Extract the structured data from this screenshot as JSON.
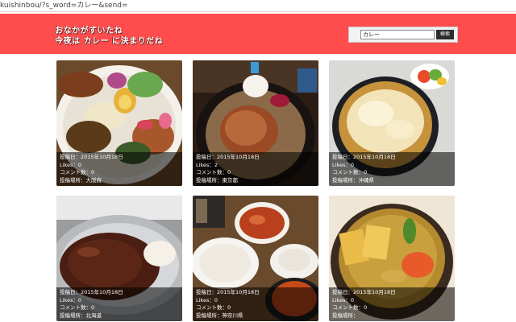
{
  "browser": {
    "url": "kuishinbou/?s_word=カレー&send="
  },
  "header": {
    "title_line1": "おなかがすいたね",
    "title_line2": "今夜は カレー に決まりだね",
    "bg_color": "#ff4d4d"
  },
  "search": {
    "value": "カレー",
    "button_label": "検索"
  },
  "labels": {
    "date": "投稿日：",
    "likes": "Likes：",
    "comments": "コメント数：",
    "place": "投稿場所："
  },
  "posts": [
    {
      "date": "2015年10月18日",
      "likes": "0",
      "comments": "0",
      "place": "大阪府"
    },
    {
      "date": "2015年10月18日",
      "likes": "2",
      "comments": "0",
      "place": "東京都"
    },
    {
      "date": "2015年10月18日",
      "likes": "0",
      "comments": "0",
      "place": "沖縄県"
    },
    {
      "date": "2015年10月18日",
      "likes": "0",
      "comments": "0",
      "place": "北海道"
    },
    {
      "date": "2015年10月18日",
      "likes": "0",
      "comments": "0",
      "place": "神奈川県"
    },
    {
      "date": "2015年10月18日",
      "likes": "0",
      "comments": "0",
      "place": ""
    }
  ]
}
